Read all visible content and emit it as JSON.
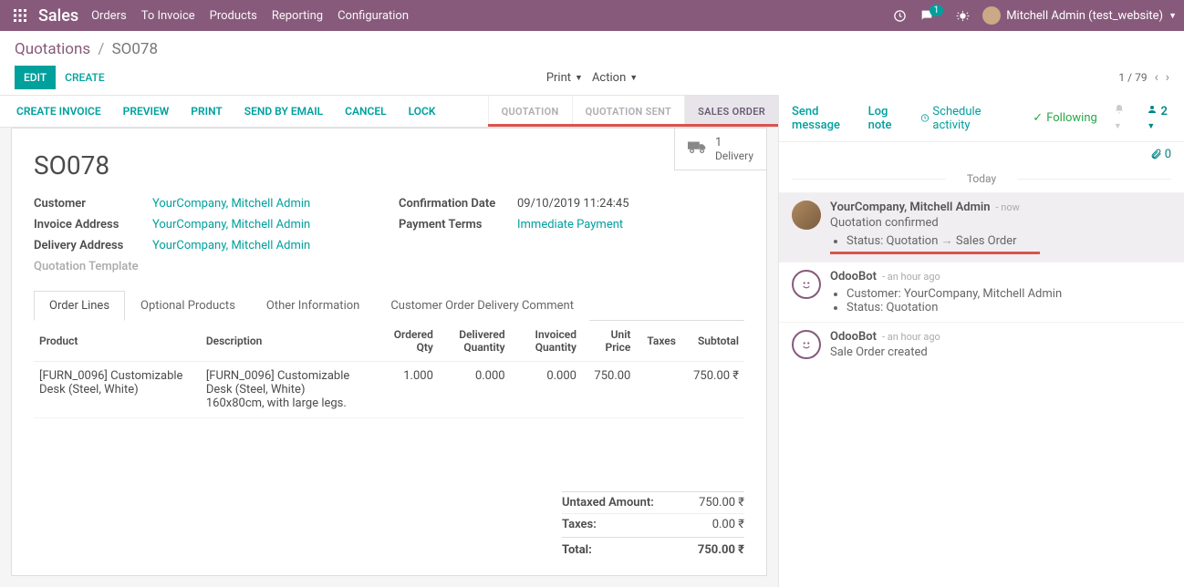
{
  "topbar": {
    "app_name": "Sales",
    "nav": [
      "Orders",
      "To Invoice",
      "Products",
      "Reporting",
      "Configuration"
    ],
    "chat_count": "1",
    "user_label": "Mitchell Admin (test_website)"
  },
  "breadcrumb": {
    "parent": "Quotations",
    "current": "SO078"
  },
  "controls": {
    "edit": "EDIT",
    "create": "CREATE",
    "print": "Print",
    "action": "Action",
    "pager": "1 / 79"
  },
  "actionbar": {
    "buttons": [
      "CREATE INVOICE",
      "PREVIEW",
      "PRINT",
      "SEND BY EMAIL",
      "CANCEL",
      "LOCK"
    ],
    "status_steps": [
      "QUOTATION",
      "QUOTATION SENT",
      "SALES ORDER"
    ]
  },
  "stat": {
    "delivery_count": "1",
    "delivery_label": "Delivery"
  },
  "record": {
    "title": "SO078",
    "left_fields": {
      "customer_label": "Customer",
      "customer_value": "YourCompany, Mitchell Admin",
      "invoice_label": "Invoice Address",
      "invoice_value": "YourCompany, Mitchell Admin",
      "delivery_label": "Delivery Address",
      "delivery_value": "YourCompany, Mitchell Admin",
      "tmpl_label": "Quotation Template"
    },
    "right_fields": {
      "conf_label": "Confirmation Date",
      "conf_value": "09/10/2019 11:24:45",
      "pay_label": "Payment Terms",
      "pay_value": "Immediate Payment"
    }
  },
  "tabs": [
    "Order Lines",
    "Optional Products",
    "Other Information",
    "Customer Order Delivery Comment"
  ],
  "order_lines": {
    "headers": [
      "Product",
      "Description",
      "Ordered Qty",
      "Delivered Quantity",
      "Invoiced Quantity",
      "Unit Price",
      "Taxes",
      "Subtotal"
    ],
    "rows": [
      {
        "product": "[FURN_0096] Customizable Desk (Steel, White)",
        "description": "[FURN_0096] Customizable Desk (Steel, White)\n160x80cm, with large legs.",
        "ordered": "1.000",
        "delivered": "0.000",
        "invoiced": "0.000",
        "unit_price": "750.00",
        "taxes": "",
        "subtotal": "750.00 ₹"
      }
    ]
  },
  "totals": {
    "untaxed_label": "Untaxed Amount:",
    "untaxed_value": "750.00 ₹",
    "taxes_label": "Taxes:",
    "taxes_value": "0.00 ₹",
    "total_label": "Total:",
    "total_value": "750.00 ₹"
  },
  "chatter": {
    "send": "Send message",
    "log": "Log note",
    "schedule": "Schedule activity",
    "following": "Following",
    "followers": "2",
    "attachments": "0",
    "today": "Today",
    "messages": [
      {
        "author": "YourCompany, Mitchell Admin",
        "time": "now",
        "highlight": true,
        "bot": false,
        "text": "Quotation confirmed",
        "bullets": [
          "Status: Quotation → Sales Order"
        ],
        "red_underline": true
      },
      {
        "author": "OdooBot",
        "time": "an hour ago",
        "highlight": false,
        "bot": true,
        "bullets": [
          "Customer: YourCompany, Mitchell Admin",
          "Status: Quotation"
        ]
      },
      {
        "author": "OdooBot",
        "time": "an hour ago",
        "highlight": false,
        "bot": true,
        "text": "Sale Order created"
      }
    ]
  }
}
